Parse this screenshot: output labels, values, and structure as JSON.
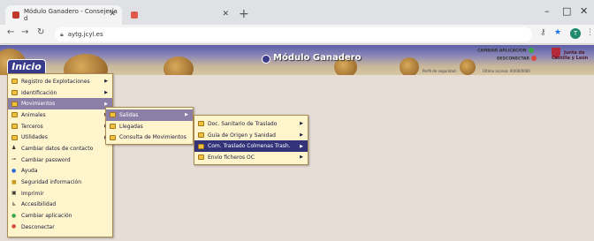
{
  "browser": {
    "tabs": [
      {
        "title": "Módulo Ganadero - Consejería d",
        "close": "✕"
      },
      {
        "title": "",
        "close": "✕"
      }
    ],
    "new_tab": "+",
    "window_controls": [
      "–",
      "□",
      "✕"
    ],
    "url": "aytg.jcyl.es",
    "profile_initial": "T"
  },
  "header": {
    "app_title": "Módulo Ganadero",
    "link_cambiar": "CAMBIAR APLICACION",
    "link_desconectar": "DESCONECTAR",
    "small_1": "Perfil de seguridad:",
    "small_2": "Último acceso: 00/00/0000",
    "junta_line1": "Junta de",
    "junta_line2": "Castilla y León"
  },
  "inicio_label": "Inicio",
  "main_menu": [
    {
      "label": "Registro de Explotaciones",
      "icon": "folder-icon",
      "arrow": true
    },
    {
      "label": "Identificación",
      "icon": "folder-icon",
      "arrow": true
    },
    {
      "label": "Movimientos",
      "icon": "folder-icon",
      "arrow": true,
      "highlighted": true
    },
    {
      "label": "Animales",
      "icon": "folder-icon",
      "arrow": true
    },
    {
      "label": "Terceros",
      "icon": "folder-icon",
      "arrow": true
    },
    {
      "label": "Utilidades",
      "icon": "folder-icon",
      "arrow": true
    },
    {
      "label": "Cambiar datos de contacto",
      "icon": "person-icon",
      "arrow": false
    },
    {
      "label": "Cambiar password",
      "icon": "key-icon",
      "arrow": false
    },
    {
      "label": "Ayuda",
      "icon": "help-icon",
      "arrow": false
    },
    {
      "label": "Seguridad información",
      "icon": "shield-icon",
      "arrow": false
    },
    {
      "label": "Imprimir",
      "icon": "printer-icon",
      "arrow": false
    },
    {
      "label": "Accesibilidad",
      "icon": "accessibility-icon",
      "arrow": false
    },
    {
      "label": "Cambiar aplicación",
      "icon": "switch-icon",
      "arrow": false
    },
    {
      "label": "Desconectar",
      "icon": "power-icon",
      "arrow": false
    }
  ],
  "movimientos_menu": [
    {
      "label": "Salidas",
      "arrow": true,
      "highlighted": true
    },
    {
      "label": "Llegadas",
      "arrow": false
    },
    {
      "label": "Consulta de Movimientos",
      "arrow": false
    }
  ],
  "salidas_menu": [
    {
      "label": "Doc. Sanitario de Traslado",
      "arrow": true
    },
    {
      "label": "Guía de Origen y Sanidad",
      "arrow": true
    },
    {
      "label": "Com. Traslado Colmenas Trash.",
      "arrow": true,
      "selected": true
    },
    {
      "label": "Envío ficheros OC",
      "arrow": true
    }
  ],
  "colors": {
    "menu_bg": "#fff5cc",
    "highlight": "#8b7fa8",
    "selected": "#33337a",
    "page_bg": "#e6ddd6"
  }
}
